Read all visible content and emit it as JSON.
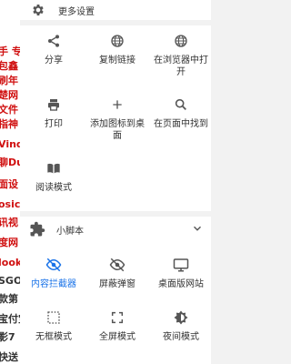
{
  "background_page": {
    "lines": [
      {
        "text": "手 专",
        "color": "red"
      },
      {
        "text": "包鑫",
        "color": "red"
      },
      {
        "text": "刷年",
        "color": "red"
      },
      {
        "text": "楚网",
        "color": "red"
      },
      {
        "text": "文件",
        "color": "red"
      },
      {
        "text": "指神",
        "color": "red"
      },
      {
        "text": "Vindo",
        "color": "red"
      },
      {
        "text": "聊Du",
        "color": "red"
      },
      {
        "text": "面设",
        "color": "red"
      },
      {
        "text": "osic自",
        "color": "red"
      },
      {
        "text": "讯视",
        "color": "red"
      },
      {
        "text": "度网",
        "color": "red"
      },
      {
        "text": "look",
        "color": "red"
      },
      {
        "text": "SGO",
        "color": "dark"
      },
      {
        "text": "款第",
        "color": "dark"
      },
      {
        "text": "宝付宝",
        "color": "dark"
      },
      {
        "text": "影7",
        "color": "dark"
      },
      {
        "text": "快送",
        "color": "dark"
      }
    ]
  },
  "menu": {
    "more_settings_label": "更多设置",
    "row1": [
      {
        "label": "分享",
        "icon": "share-icon"
      },
      {
        "label": "复制链接",
        "icon": "globe-icon"
      },
      {
        "label": "在浏览器中打\n开",
        "icon": "globe-icon"
      }
    ],
    "row2": [
      {
        "label": "打印",
        "icon": "print-icon"
      },
      {
        "label": "添加图标到桌\n面",
        "icon": "plus-icon"
      },
      {
        "label": "在页面中找到",
        "icon": "search-icon"
      }
    ],
    "row3": [
      {
        "label": "阅读模式",
        "icon": "book-icon"
      }
    ],
    "scripts_section_title": "小脚本",
    "row4": [
      {
        "label": "内容拦截器",
        "icon": "eye-off-icon",
        "active": true
      },
      {
        "label": "屏蔽弹窗",
        "icon": "eye-off-icon",
        "active": false
      },
      {
        "label": "桌面版网站",
        "icon": "monitor-icon",
        "active": false
      }
    ],
    "row5": [
      {
        "label": "无框模式",
        "icon": "frame-icon"
      },
      {
        "label": "全屏模式",
        "icon": "fullscreen-icon"
      },
      {
        "label": "夜间模式",
        "icon": "night-icon"
      }
    ]
  },
  "colors": {
    "accent": "#1a73e8",
    "icon": "#555555",
    "text": "#333333"
  }
}
